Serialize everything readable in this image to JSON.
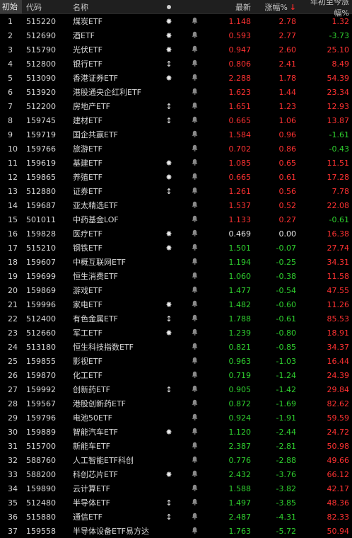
{
  "header": {
    "corner": "初始",
    "code": "代码",
    "name": "名称",
    "price": "最新",
    "change": "涨幅%",
    "sort_arrow": "↓",
    "ytd": "年初至今涨幅%"
  },
  "colors": {
    "up": "#ff3232",
    "down": "#2fd02f",
    "flat": "#e8e8e8"
  },
  "rows": [
    {
      "idx": "1",
      "code": "515220",
      "name": "煤炭ETF",
      "mark": "✸",
      "price": "1.148",
      "change": "2.78",
      "ytd": "1.32",
      "price_dir": "up",
      "change_dir": "up",
      "ytd_dir": "up"
    },
    {
      "idx": "2",
      "code": "512690",
      "name": "酒ETF",
      "mark": "✸",
      "price": "0.593",
      "change": "2.77",
      "ytd": "-3.73",
      "price_dir": "up",
      "change_dir": "up",
      "ytd_dir": "down"
    },
    {
      "idx": "3",
      "code": "515790",
      "name": "光伏ETF",
      "mark": "✸",
      "price": "0.947",
      "change": "2.60",
      "ytd": "25.10",
      "price_dir": "up",
      "change_dir": "up",
      "ytd_dir": "up"
    },
    {
      "idx": "4",
      "code": "512800",
      "name": "银行ETF",
      "mark": "↕",
      "price": "0.806",
      "change": "2.41",
      "ytd": "8.49",
      "price_dir": "up",
      "change_dir": "up",
      "ytd_dir": "up"
    },
    {
      "idx": "5",
      "code": "513090",
      "name": "香港证券ETF",
      "mark": "✸",
      "price": "2.288",
      "change": "1.78",
      "ytd": "54.39",
      "price_dir": "up",
      "change_dir": "up",
      "ytd_dir": "up"
    },
    {
      "idx": "6",
      "code": "513920",
      "name": "港股通央企红利ETF",
      "mark": "",
      "price": "1.623",
      "change": "1.44",
      "ytd": "23.34",
      "price_dir": "up",
      "change_dir": "up",
      "ytd_dir": "up"
    },
    {
      "idx": "7",
      "code": "512200",
      "name": "房地产ETF",
      "mark": "↕",
      "price": "1.651",
      "change": "1.23",
      "ytd": "12.93",
      "price_dir": "up",
      "change_dir": "up",
      "ytd_dir": "up"
    },
    {
      "idx": "8",
      "code": "159745",
      "name": "建材ETF",
      "mark": "↕",
      "price": "0.665",
      "change": "1.06",
      "ytd": "13.87",
      "price_dir": "up",
      "change_dir": "up",
      "ytd_dir": "up"
    },
    {
      "idx": "9",
      "code": "159719",
      "name": "国企共赢ETF",
      "mark": "",
      "price": "1.584",
      "change": "0.96",
      "ytd": "-1.61",
      "price_dir": "up",
      "change_dir": "up",
      "ytd_dir": "down"
    },
    {
      "idx": "10",
      "code": "159766",
      "name": "旅游ETF",
      "mark": "",
      "price": "0.702",
      "change": "0.86",
      "ytd": "-0.43",
      "price_dir": "up",
      "change_dir": "up",
      "ytd_dir": "down"
    },
    {
      "idx": "11",
      "code": "159619",
      "name": "基建ETF",
      "mark": "✸",
      "price": "1.085",
      "change": "0.65",
      "ytd": "11.51",
      "price_dir": "up",
      "change_dir": "up",
      "ytd_dir": "up"
    },
    {
      "idx": "12",
      "code": "159865",
      "name": "养殖ETF",
      "mark": "✸",
      "price": "0.665",
      "change": "0.61",
      "ytd": "17.28",
      "price_dir": "up",
      "change_dir": "up",
      "ytd_dir": "up"
    },
    {
      "idx": "13",
      "code": "512880",
      "name": "证券ETF",
      "mark": "↕",
      "price": "1.261",
      "change": "0.56",
      "ytd": "7.78",
      "price_dir": "up",
      "change_dir": "up",
      "ytd_dir": "up"
    },
    {
      "idx": "14",
      "code": "159687",
      "name": "亚太精选ETF",
      "mark": "",
      "price": "1.537",
      "change": "0.52",
      "ytd": "22.08",
      "price_dir": "up",
      "change_dir": "up",
      "ytd_dir": "up"
    },
    {
      "idx": "15",
      "code": "501011",
      "name": "中药基金LOF",
      "mark": "",
      "price": "1.133",
      "change": "0.27",
      "ytd": "-0.61",
      "price_dir": "up",
      "change_dir": "up",
      "ytd_dir": "down"
    },
    {
      "idx": "16",
      "code": "159828",
      "name": "医疗ETF",
      "mark": "✸",
      "price": "0.469",
      "change": "0.00",
      "ytd": "16.38",
      "price_dir": "flat",
      "change_dir": "flat",
      "ytd_dir": "up"
    },
    {
      "idx": "17",
      "code": "515210",
      "name": "钢铁ETF",
      "mark": "✸",
      "price": "1.501",
      "change": "-0.07",
      "ytd": "27.74",
      "price_dir": "down",
      "change_dir": "down",
      "ytd_dir": "up"
    },
    {
      "idx": "18",
      "code": "159607",
      "name": "中概互联网ETF",
      "mark": "",
      "price": "1.194",
      "change": "-0.25",
      "ytd": "34.31",
      "price_dir": "down",
      "change_dir": "down",
      "ytd_dir": "up"
    },
    {
      "idx": "19",
      "code": "159699",
      "name": "恒生消费ETF",
      "mark": "",
      "price": "1.060",
      "change": "-0.38",
      "ytd": "11.58",
      "price_dir": "down",
      "change_dir": "down",
      "ytd_dir": "up"
    },
    {
      "idx": "20",
      "code": "159869",
      "name": "游戏ETF",
      "mark": "",
      "price": "1.477",
      "change": "-0.54",
      "ytd": "47.55",
      "price_dir": "down",
      "change_dir": "down",
      "ytd_dir": "up"
    },
    {
      "idx": "21",
      "code": "159996",
      "name": "家电ETF",
      "mark": "✸",
      "price": "1.482",
      "change": "-0.60",
      "ytd": "11.26",
      "price_dir": "down",
      "change_dir": "down",
      "ytd_dir": "up"
    },
    {
      "idx": "22",
      "code": "512400",
      "name": "有色金属ETF",
      "mark": "↕",
      "price": "1.788",
      "change": "-0.61",
      "ytd": "85.53",
      "price_dir": "down",
      "change_dir": "down",
      "ytd_dir": "up"
    },
    {
      "idx": "23",
      "code": "512660",
      "name": "军工ETF",
      "mark": "✸",
      "price": "1.239",
      "change": "-0.80",
      "ytd": "18.91",
      "price_dir": "down",
      "change_dir": "down",
      "ytd_dir": "up"
    },
    {
      "idx": "24",
      "code": "513180",
      "name": "恒生科技指数ETF",
      "mark": "",
      "price": "0.821",
      "change": "-0.85",
      "ytd": "34.37",
      "price_dir": "down",
      "change_dir": "down",
      "ytd_dir": "up"
    },
    {
      "idx": "25",
      "code": "159855",
      "name": "影视ETF",
      "mark": "",
      "price": "0.963",
      "change": "-1.03",
      "ytd": "16.44",
      "price_dir": "down",
      "change_dir": "down",
      "ytd_dir": "up"
    },
    {
      "idx": "26",
      "code": "159870",
      "name": "化工ETF",
      "mark": "",
      "price": "0.719",
      "change": "-1.24",
      "ytd": "24.39",
      "price_dir": "down",
      "change_dir": "down",
      "ytd_dir": "up"
    },
    {
      "idx": "27",
      "code": "159992",
      "name": "创新药ETF",
      "mark": "↕",
      "price": "0.905",
      "change": "-1.42",
      "ytd": "29.84",
      "price_dir": "down",
      "change_dir": "down",
      "ytd_dir": "up"
    },
    {
      "idx": "28",
      "code": "159567",
      "name": "港股创新药ETF",
      "mark": "",
      "price": "0.872",
      "change": "-1.69",
      "ytd": "82.62",
      "price_dir": "down",
      "change_dir": "down",
      "ytd_dir": "up"
    },
    {
      "idx": "29",
      "code": "159796",
      "name": "电池50ETF",
      "mark": "",
      "price": "0.924",
      "change": "-1.91",
      "ytd": "59.59",
      "price_dir": "down",
      "change_dir": "down",
      "ytd_dir": "up"
    },
    {
      "idx": "30",
      "code": "159889",
      "name": "智能汽车ETF",
      "mark": "✸",
      "price": "1.120",
      "change": "-2.44",
      "ytd": "24.72",
      "price_dir": "down",
      "change_dir": "down",
      "ytd_dir": "up"
    },
    {
      "idx": "31",
      "code": "515700",
      "name": "新能车ETF",
      "mark": "",
      "price": "2.387",
      "change": "-2.81",
      "ytd": "50.98",
      "price_dir": "down",
      "change_dir": "down",
      "ytd_dir": "up"
    },
    {
      "idx": "32",
      "code": "588760",
      "name": "人工智能ETF科创",
      "mark": "",
      "price": "0.776",
      "change": "-2.88",
      "ytd": "49.66",
      "price_dir": "down",
      "change_dir": "down",
      "ytd_dir": "up"
    },
    {
      "idx": "33",
      "code": "588200",
      "name": "科创芯片ETF",
      "mark": "✸",
      "price": "2.432",
      "change": "-3.76",
      "ytd": "66.12",
      "price_dir": "down",
      "change_dir": "down",
      "ytd_dir": "up"
    },
    {
      "idx": "34",
      "code": "159890",
      "name": "云计算ETF",
      "mark": "",
      "price": "1.588",
      "change": "-3.82",
      "ytd": "42.17",
      "price_dir": "down",
      "change_dir": "down",
      "ytd_dir": "up"
    },
    {
      "idx": "35",
      "code": "512480",
      "name": "半导体ETF",
      "mark": "↕",
      "price": "1.497",
      "change": "-3.85",
      "ytd": "48.36",
      "price_dir": "down",
      "change_dir": "down",
      "ytd_dir": "up"
    },
    {
      "idx": "36",
      "code": "515880",
      "name": "通信ETF",
      "mark": "↕",
      "price": "2.487",
      "change": "-4.31",
      "ytd": "82.33",
      "price_dir": "down",
      "change_dir": "down",
      "ytd_dir": "up"
    },
    {
      "idx": "37",
      "code": "159558",
      "name": "半导体设备ETF易方达",
      "mark": "",
      "price": "1.763",
      "change": "-5.72",
      "ytd": "50.94",
      "price_dir": "down",
      "change_dir": "down",
      "ytd_dir": "up"
    }
  ]
}
